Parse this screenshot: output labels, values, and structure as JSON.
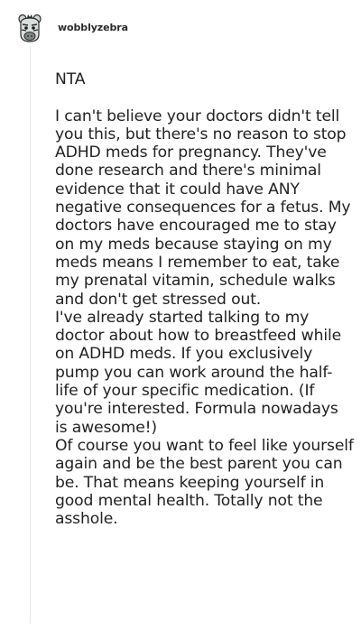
{
  "post": {
    "username": "wobblyzebra",
    "avatar_icon": "zebra-avatar-icon",
    "paragraphs": [
      "NTA",
      "I can't believe your doctors didn't tell you this, but there's no reason to stop ADHD meds for pregnancy. They've done research and there's minimal evidence that it could have ANY negative consequences for a fetus. My doctors have encouraged me to stay on my meds because staying on my meds means I remember to eat, take my prenatal vitamin, schedule walks and don't get stressed out.",
      "I've already started talking to my doctor about how to breastfeed while on ADHD meds. If you exclusively pump you can work around the half-life of your specific medication. (If you're interested. Formula nowadays is awesome!)",
      "Of course you want to feel like yourself again and be the best parent you can be. That means keeping yourself in good mental health. Totally not the asshole."
    ]
  }
}
